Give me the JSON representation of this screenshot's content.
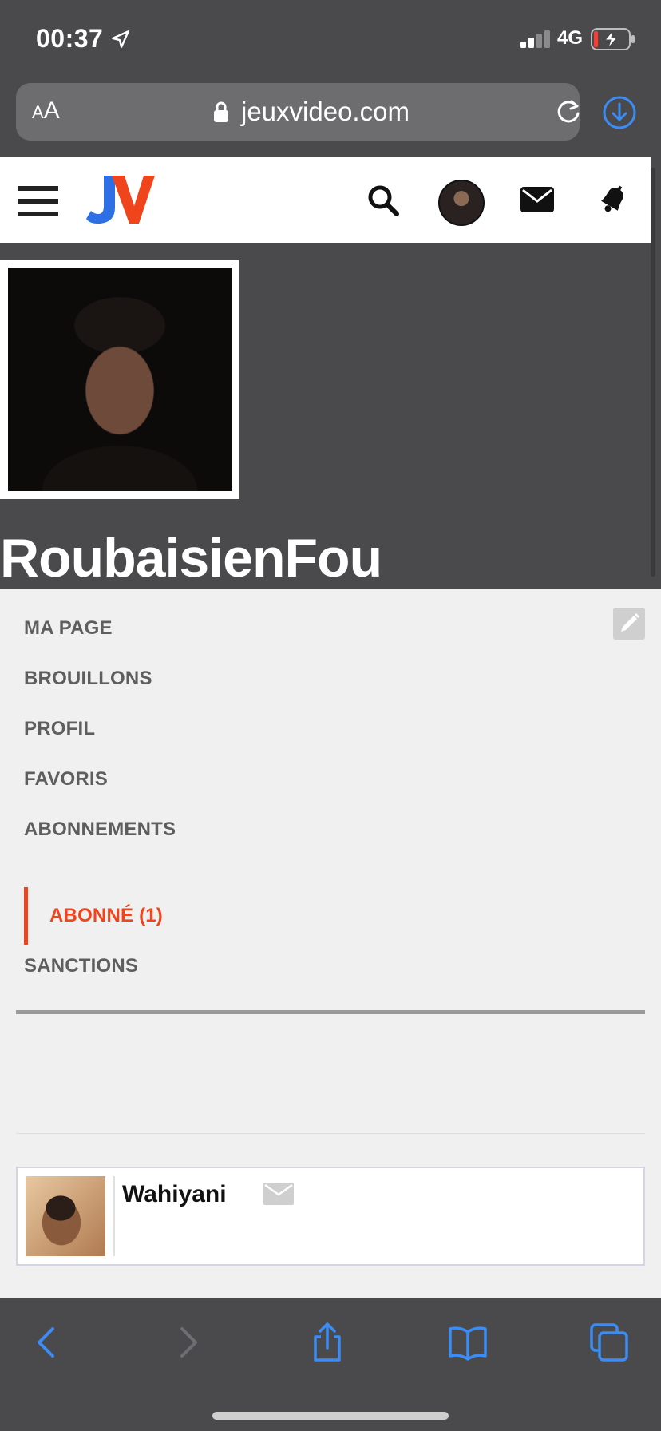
{
  "status_bar": {
    "time": "00:37",
    "network": "4G"
  },
  "browser": {
    "aa_label": "AA",
    "url": "jeuxvideo.com"
  },
  "profile": {
    "username": "RoubaisienFou"
  },
  "nav": {
    "items": [
      {
        "label": "MA PAGE",
        "active": false
      },
      {
        "label": "BROUILLONS",
        "active": false
      },
      {
        "label": "PROFIL",
        "active": false
      },
      {
        "label": "FAVORIS",
        "active": false
      },
      {
        "label": "ABONNEMENTS",
        "active": false
      },
      {
        "label": "ABONNÉ (1)",
        "active": true
      },
      {
        "label": "SANCTIONS",
        "active": false
      }
    ]
  },
  "subscribers": [
    {
      "name": "Wahiyani"
    }
  ],
  "colors": {
    "accent": "#f0441c",
    "logo_blue": "#2e6fe6",
    "ios_blue": "#3b8cf5",
    "chrome_bg": "#4a4a4c"
  }
}
